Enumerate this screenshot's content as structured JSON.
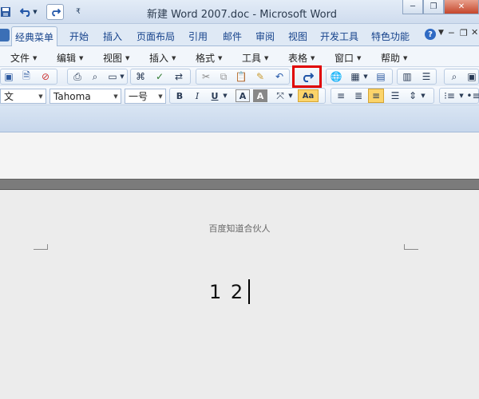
{
  "titlebar": {
    "title": "新建 Word 2007.doc - Microsoft Word",
    "icons": [
      "save-icon",
      "undo-icon",
      "redo-icon",
      "customize-qat-icon"
    ],
    "controls": [
      "minimize-icon",
      "restore-icon",
      "close-icon"
    ]
  },
  "tabs": [
    {
      "label": "经典菜单",
      "active": true
    },
    {
      "label": "开始"
    },
    {
      "label": "插入"
    },
    {
      "label": "页面布局"
    },
    {
      "label": "引用"
    },
    {
      "label": "邮件"
    },
    {
      "label": "审阅"
    },
    {
      "label": "视图"
    },
    {
      "label": "开发工具"
    },
    {
      "label": "特色功能"
    }
  ],
  "menus": [
    {
      "label": "文件"
    },
    {
      "label": "编辑"
    },
    {
      "label": "视图"
    },
    {
      "label": "插入"
    },
    {
      "label": "格式"
    },
    {
      "label": "工具"
    },
    {
      "label": "表格"
    },
    {
      "label": "窗口"
    },
    {
      "label": "帮助"
    }
  ],
  "formatting": {
    "style_partial": "文",
    "font_name": "Tahoma",
    "font_size": "一号",
    "bold": "B",
    "italic": "I",
    "underline": "U",
    "font_color": "A",
    "shading": "A",
    "change_case": "Aa"
  },
  "document": {
    "header_text": "百度知道合伙人",
    "body_text": "1 2"
  },
  "colors": {
    "highlight_box": "#e00000",
    "accent": "#15428b"
  }
}
